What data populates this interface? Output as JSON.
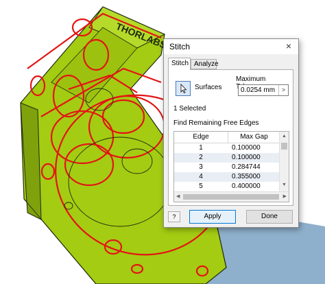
{
  "viewport": {
    "brand_text": "THORLABS",
    "colors": {
      "part": "#a4cc12",
      "edge": "#e31414",
      "outline": "#1f2a10",
      "background": "#ffffff",
      "floor": "#7ea3c4"
    }
  },
  "dialog": {
    "title": "Stitch",
    "close_icon": "×",
    "tabs": [
      {
        "label": "Stitch",
        "active": true
      },
      {
        "label": "Analyze",
        "active": false
      }
    ],
    "surfaces_label": "Surfaces",
    "surfaces_icon": "cursor-arrow-icon",
    "max_tolerance_label": "Maximum Tolerance",
    "tolerance_value": "0.0254 mm",
    "tolerance_arrow": ">",
    "selected_count": "1 Selected",
    "find_label": "Find Remaining Free Edges",
    "table": {
      "headers": [
        "Edge",
        "Max Gap"
      ],
      "rows": [
        {
          "edge": "1",
          "gap": "0.100000"
        },
        {
          "edge": "2",
          "gap": "0.100000"
        },
        {
          "edge": "3",
          "gap": "0.284744"
        },
        {
          "edge": "4",
          "gap": "0.355000"
        },
        {
          "edge": "5",
          "gap": "0.400000"
        }
      ]
    },
    "help_label": "?",
    "apply_label": "Apply",
    "done_label": "Done"
  }
}
